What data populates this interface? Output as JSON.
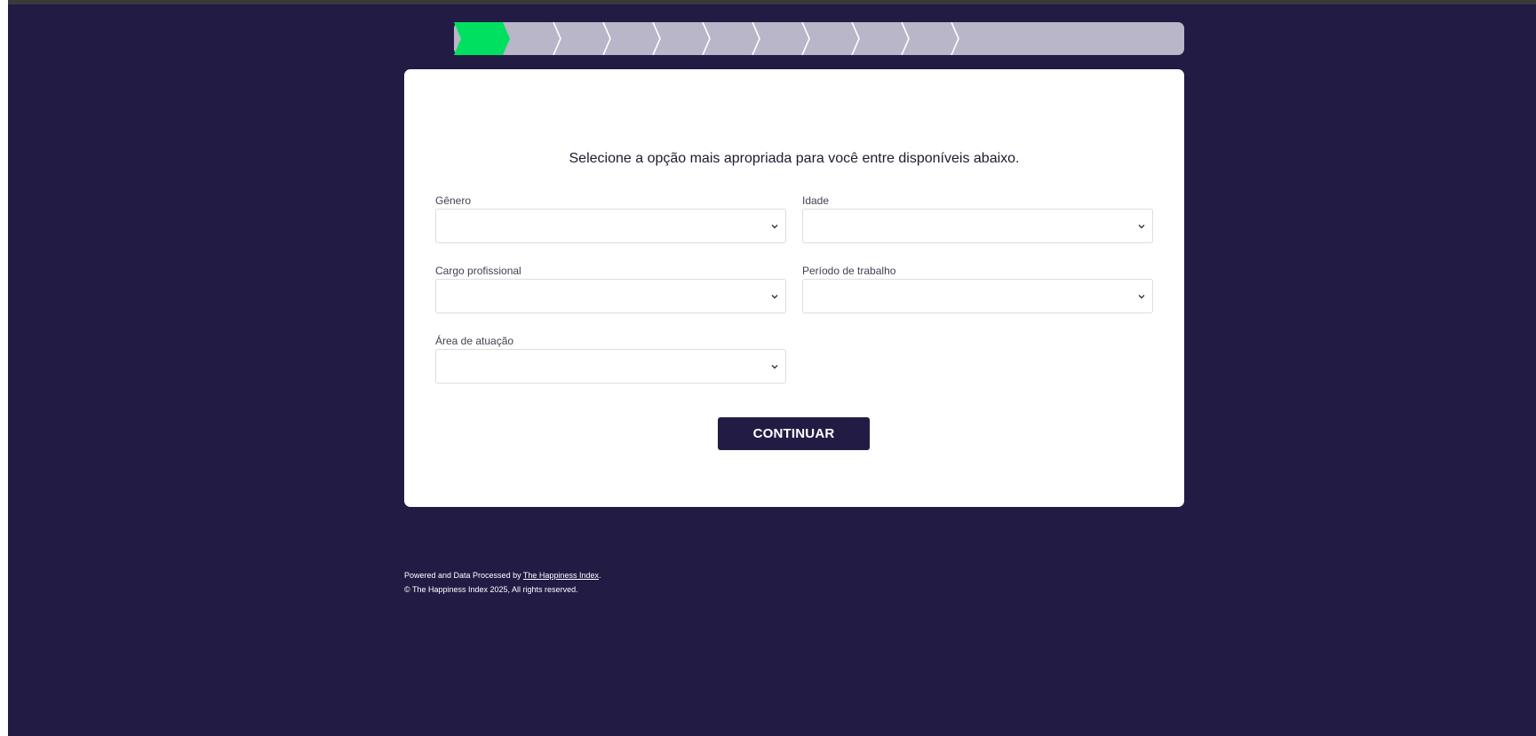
{
  "progress": {
    "total_steps": 10,
    "current_step": 1,
    "active_color": "#00e060",
    "inactive_color": "#b8b6c8"
  },
  "form": {
    "intro": "Selecione a opção mais apropriada para você entre disponíveis abaixo.",
    "fields": [
      {
        "label": "Gênero",
        "value": ""
      },
      {
        "label": "Idade",
        "value": ""
      },
      {
        "label": "Cargo profissional",
        "value": ""
      },
      {
        "label": "Período de trabalho",
        "value": ""
      },
      {
        "label": "Área de atuação",
        "value": ""
      }
    ],
    "submit_label": "CONTINUAR"
  },
  "footer": {
    "powered_text": "Powered and Data Processed by ",
    "powered_link": "The Happiness Index",
    "powered_suffix": ".",
    "copyright": "© The Happiness Index 2025, All rights reserved."
  },
  "colors": {
    "background": "#221c45",
    "card": "#ffffff",
    "button": "#221c45"
  }
}
